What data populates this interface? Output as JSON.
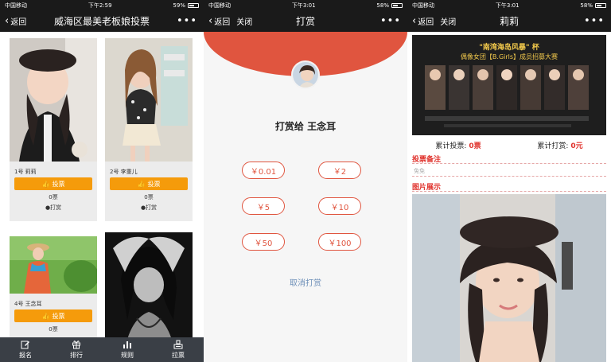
{
  "panel1": {
    "status": {
      "carrier": "中国移动",
      "time": "下午2:59",
      "battery": "59%",
      "battery_level": 0.59
    },
    "nav": {
      "back": "返回",
      "title": "威海区最美老板娘投票",
      "more": "•••"
    },
    "cards": [
      {
        "label": "1号 莉莉",
        "vote_button": "投票",
        "votes": "0票",
        "reward": "打赏"
      },
      {
        "label": "2号 李重儿",
        "vote_button": "投票",
        "votes": "0票",
        "reward": "打赏"
      },
      {
        "label": "4号 王念耳",
        "vote_button": "投票",
        "votes": "0票"
      },
      {
        "label": ""
      }
    ],
    "tabs": [
      {
        "label": "报名",
        "icon": "edit-icon"
      },
      {
        "label": "排行",
        "icon": "gift-icon"
      },
      {
        "label": "规则",
        "icon": "bar-chart-icon"
      },
      {
        "label": "拉票",
        "icon": "share-icon"
      }
    ]
  },
  "panel2": {
    "status": {
      "carrier": "中国移动",
      "time": "下午3:01",
      "battery": "58%",
      "battery_level": 0.58
    },
    "nav": {
      "back": "返回",
      "close": "关闭",
      "title": "打赏",
      "more": "•••"
    },
    "reward_to": "打赏给 王念耳",
    "amounts": [
      "￥0.01",
      "￥2",
      "￥5",
      "￥10",
      "￥50",
      "￥100"
    ],
    "cancel": "取消打赏"
  },
  "panel3": {
    "status": {
      "carrier": "中国移动",
      "time": "下午3:01",
      "battery": "58%",
      "battery_level": 0.58
    },
    "nav": {
      "back": "返回",
      "close": "关闭",
      "title": "莉莉",
      "more": "•••"
    },
    "banner_title": "\"南湾海岛风暴\" 杯",
    "banner_subtitle": "偶像女团【B.Girls】成员招募大赛",
    "stats": {
      "votes_label": "累计投票:",
      "votes_value": "0票",
      "reward_label": "累计打赏:",
      "reward_value": "0元"
    },
    "note_title": "投票备注",
    "note_text": "免免",
    "gallery_title": "图片展示"
  },
  "colors": {
    "accent": "#e0553f",
    "vote": "#f59b0b",
    "dark": "#1a1a1a",
    "tabbar": "#3a3f46",
    "link": "#6d8fb8"
  }
}
